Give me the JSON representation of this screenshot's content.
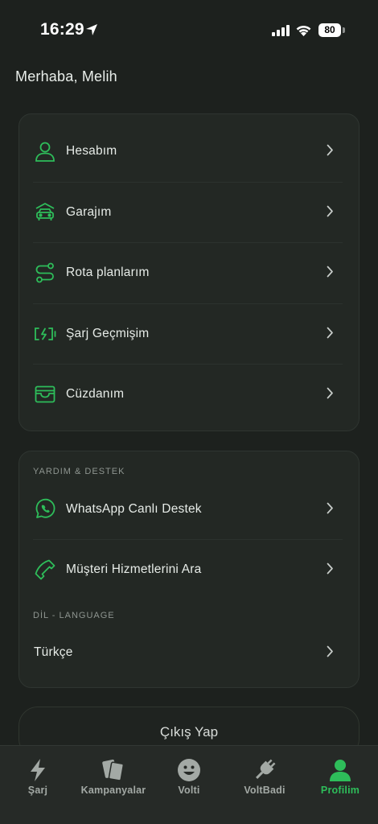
{
  "status_bar": {
    "time": "16:29",
    "battery": "80"
  },
  "greeting": "Merhaba, Melih",
  "menu": {
    "items": [
      {
        "label": "Hesabım",
        "icon": "user-icon"
      },
      {
        "label": "Garajım",
        "icon": "car-garage-icon"
      },
      {
        "label": "Rota planlarım",
        "icon": "route-icon"
      },
      {
        "label": "Şarj Geçmişim",
        "icon": "battery-charging-icon"
      },
      {
        "label": "Cüzdanım",
        "icon": "wallet-icon"
      }
    ]
  },
  "support": {
    "section_title": "YARDIM & DESTEK",
    "items": [
      {
        "label": "WhatsApp Canlı Destek",
        "icon": "whatsapp-icon"
      },
      {
        "label": "Müşteri Hizmetlerini Ara",
        "icon": "phone-icon"
      }
    ]
  },
  "language": {
    "section_title": "DİL - LANGUAGE",
    "selected": "Türkçe"
  },
  "logout_label": "Çıkış Yap",
  "tab_bar": {
    "tabs": [
      {
        "label": "Şarj",
        "icon": "lightning-icon",
        "active": false
      },
      {
        "label": "Kampanyalar",
        "icon": "cards-icon",
        "active": false
      },
      {
        "label": "Volti",
        "icon": "smiley-icon",
        "active": false
      },
      {
        "label": "VoltBadi",
        "icon": "plug-icon",
        "active": false
      },
      {
        "label": "Profilim",
        "icon": "profile-icon",
        "active": true
      }
    ]
  },
  "colors": {
    "accent": "#2ebd5a",
    "background": "#1d211e",
    "card": "#232824"
  }
}
